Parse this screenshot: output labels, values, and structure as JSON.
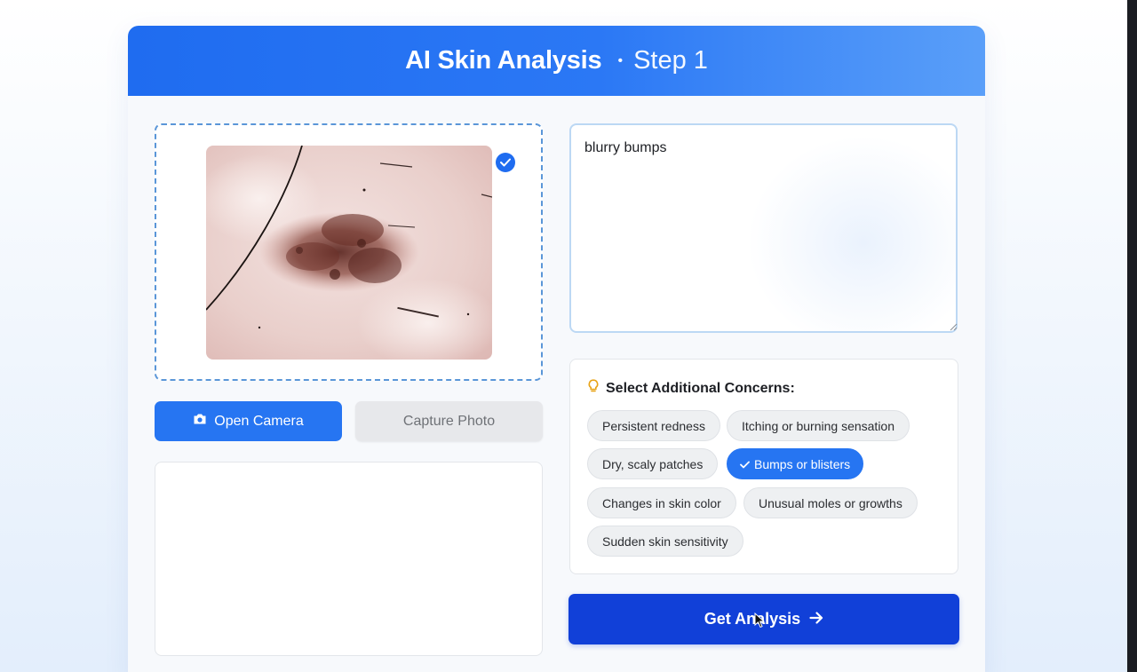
{
  "header": {
    "title": "AI Skin Analysis",
    "separator": "•",
    "step": "Step 1"
  },
  "upload": {
    "status": "uploaded"
  },
  "buttons": {
    "open_camera": "Open Camera",
    "capture_photo": "Capture Photo",
    "get_analysis": "Get Analysis"
  },
  "symptom_input": {
    "value": "blurry bumps"
  },
  "concerns": {
    "heading": "Select Additional Concerns:",
    "chips": [
      {
        "label": "Persistent redness",
        "selected": false
      },
      {
        "label": "Itching or burning sensation",
        "selected": false
      },
      {
        "label": "Dry, scaly patches",
        "selected": false
      },
      {
        "label": "Bumps or blisters",
        "selected": true
      },
      {
        "label": "Changes in skin color",
        "selected": false
      },
      {
        "label": "Unusual moles or growths",
        "selected": false
      },
      {
        "label": "Sudden skin sensitivity",
        "selected": false
      }
    ]
  },
  "colors": {
    "header_start": "#1f6cf0",
    "header_end": "#5a9ff9",
    "primary": "#2675f2",
    "analysis_button": "#1140d8",
    "dashed_border": "#5a96d8"
  },
  "icons": {
    "camera": "camera-icon",
    "check": "check-icon",
    "lightbulb": "lightbulb-icon",
    "arrow": "arrow-right-icon"
  }
}
